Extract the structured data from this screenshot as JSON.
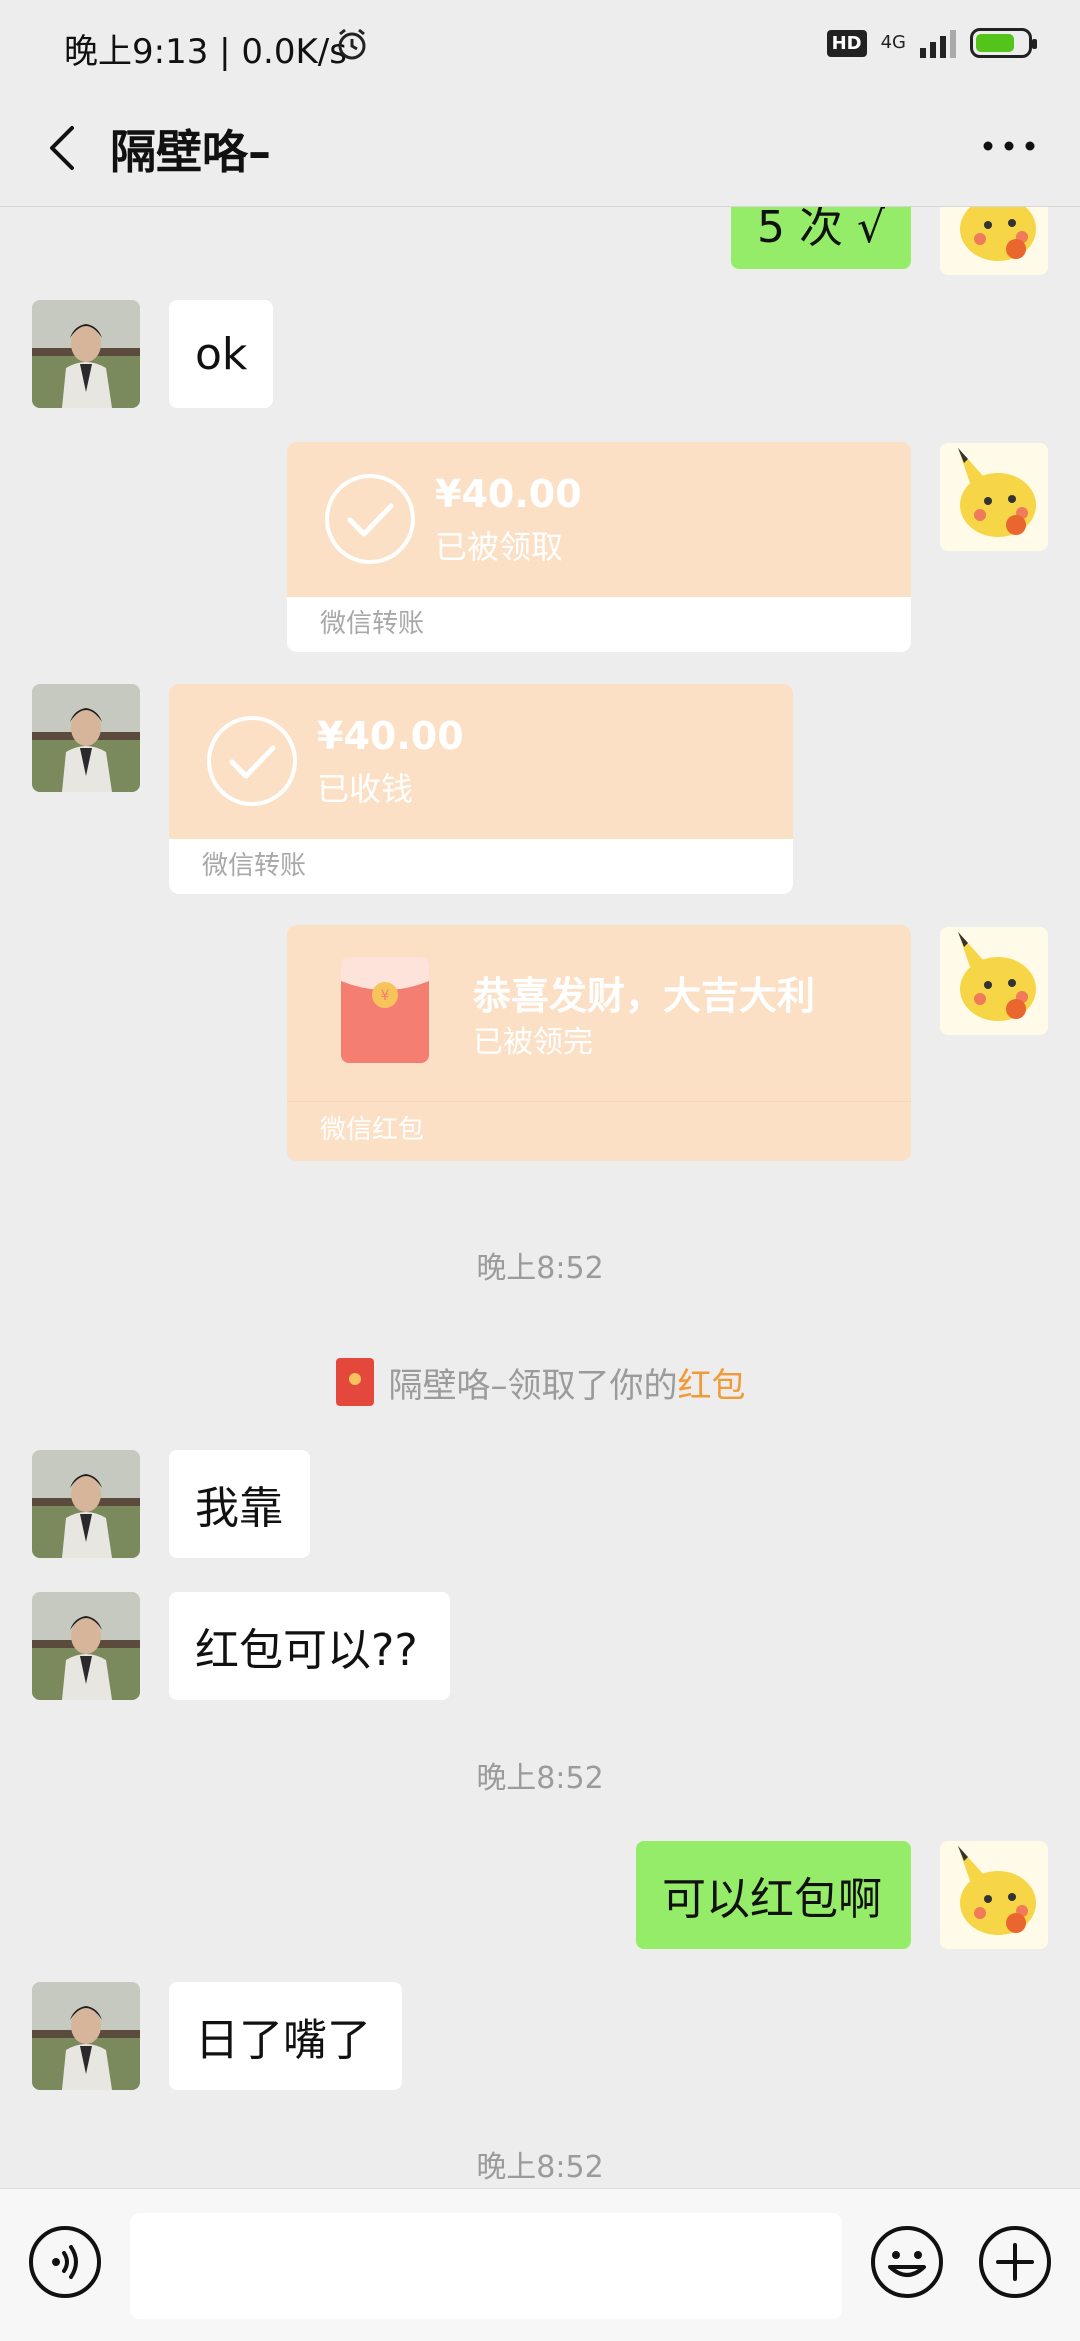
{
  "status_bar": {
    "text": "晚上9:13 | 0.0K/s",
    "hd": "HD",
    "network": "4G"
  },
  "header": {
    "title": "隔壁咯–"
  },
  "messages": {
    "partial_right": "5 次 √",
    "ok": "ok",
    "transfer_sent": {
      "amount": "¥40.00",
      "status": "已被领取",
      "label": "微信转账"
    },
    "transfer_received": {
      "amount": "¥40.00",
      "status": "已收钱",
      "label": "微信转账"
    },
    "red_packet": {
      "wish": "恭喜发财，大吉大利",
      "status": "已被领完",
      "label": "微信红包"
    },
    "time1": "晚上8:52",
    "system_prefix": "隔壁咯–领取了你的",
    "system_link": "红包",
    "m1": "我靠",
    "m2": "红包可以??",
    "time2": "晚上8:52",
    "m3": "可以红包啊",
    "m4": "日了嘴了",
    "time3": "晚上8:52"
  },
  "input": {
    "value": "",
    "placeholder": ""
  },
  "colors": {
    "bubble_right": "#95ec69",
    "card": "#fbe0c6",
    "link": "#f29a38",
    "red_packet": "#f47e72"
  }
}
